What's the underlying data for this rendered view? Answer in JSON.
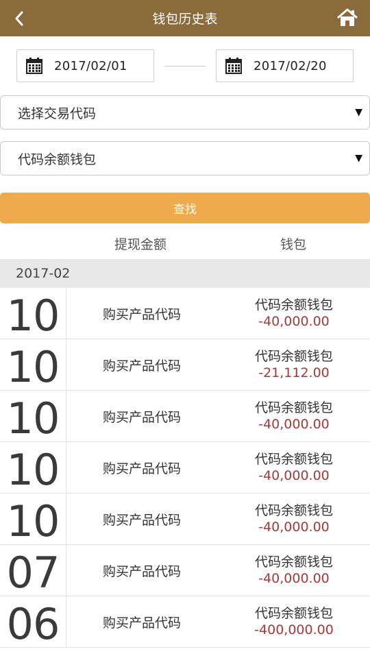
{
  "header": {
    "title": "钱包历史表",
    "back_icon": "back-arrow-icon",
    "home_icon": "home-icon"
  },
  "filters": {
    "start_date": "2017/02/01",
    "end_date": "2017/02/20",
    "trade_code_select": "选择交易代码",
    "wallet_select": "代码余额钱包",
    "search_label": "查找"
  },
  "columns": {
    "amount_header": "提现金额",
    "wallet_header": "钱包"
  },
  "month": "2017-02",
  "rows": [
    {
      "day": "10",
      "desc": "购买产品代码",
      "wallet": "代码余额钱包",
      "amount": "-40,000.00"
    },
    {
      "day": "10",
      "desc": "购买产品代码",
      "wallet": "代码余额钱包",
      "amount": "-21,112.00"
    },
    {
      "day": "10",
      "desc": "购买产品代码",
      "wallet": "代码余额钱包",
      "amount": "-40,000.00"
    },
    {
      "day": "10",
      "desc": "购买产品代码",
      "wallet": "代码余额钱包",
      "amount": "-40,000.00"
    },
    {
      "day": "10",
      "desc": "购买产品代码",
      "wallet": "代码余额钱包",
      "amount": "-40,000.00"
    },
    {
      "day": "07",
      "desc": "购买产品代码",
      "wallet": "代码余额钱包",
      "amount": "-40,000.00"
    },
    {
      "day": "06",
      "desc": "购买产品代码",
      "wallet": "代码余额钱包",
      "amount": "-400,000.00"
    }
  ],
  "colors": {
    "header_bg": "#8b6a3c",
    "button_bg": "#eeaa4c",
    "amount_negative": "#a33a3a"
  }
}
